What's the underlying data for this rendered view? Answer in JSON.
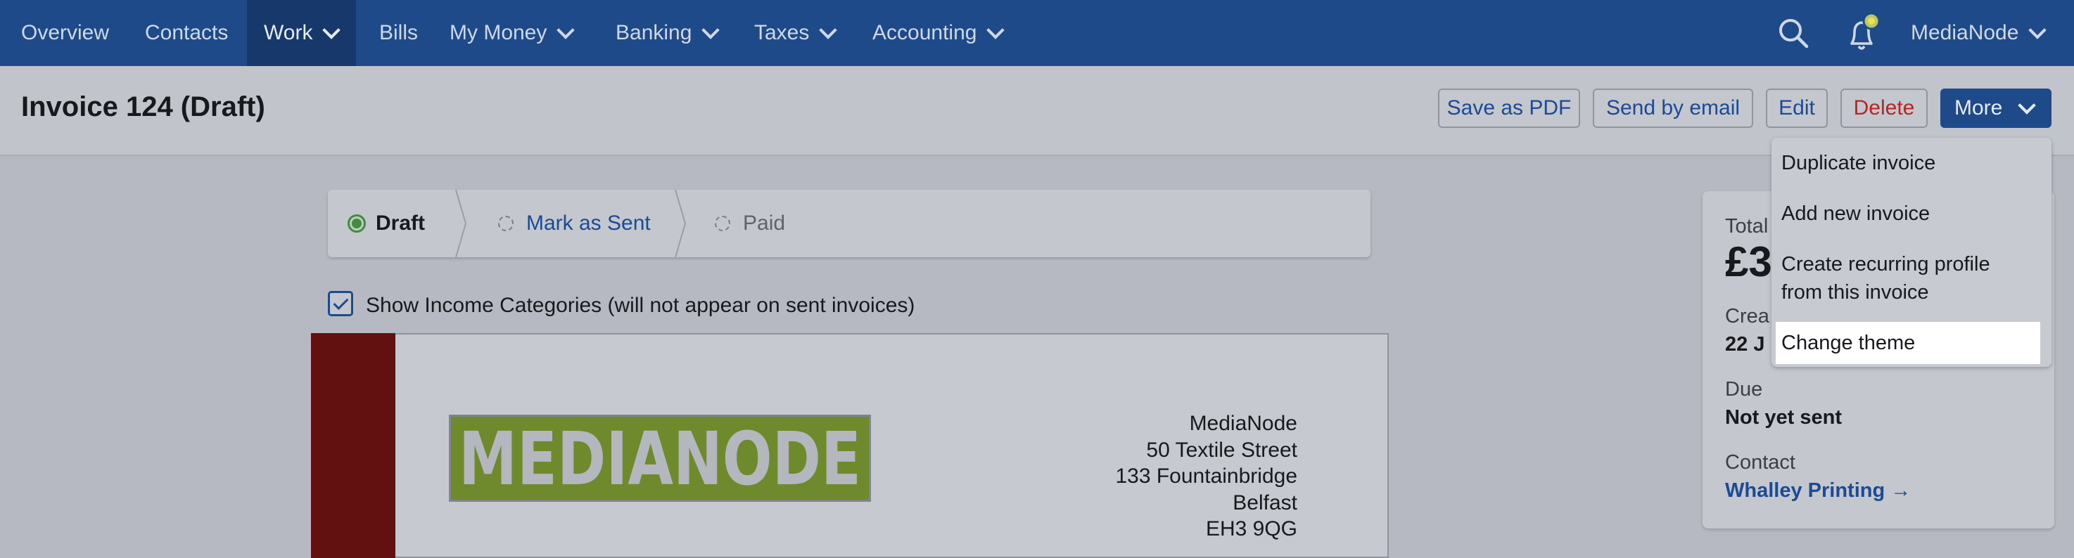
{
  "nav": {
    "items": [
      {
        "label": "Overview"
      },
      {
        "label": "Contacts"
      },
      {
        "label": "Work"
      },
      {
        "label": "Bills"
      },
      {
        "label": "My Money"
      },
      {
        "label": "Banking"
      },
      {
        "label": "Taxes"
      },
      {
        "label": "Accounting"
      }
    ],
    "account_label": "MediaNode",
    "icons": [
      "search-icon",
      "bell-icon",
      "chevron-down-icon"
    ],
    "colors": {
      "bar": "#1f4a8a",
      "active": "#16386b"
    }
  },
  "header": {
    "title": "Invoice 124 (Draft)",
    "buttons": {
      "save_pdf": "Save as PDF",
      "send_email": "Send by email",
      "edit": "Edit",
      "delete": "Delete",
      "more": "More"
    }
  },
  "menu": {
    "items": [
      "Duplicate invoice",
      "Add new invoice",
      "Create recurring profile",
      "from this invoice",
      "Change theme"
    ],
    "highlighted": "Change theme"
  },
  "steps": {
    "draft": "Draft",
    "sent": "Mark as Sent",
    "paid": "Paid",
    "current": "Draft"
  },
  "options": {
    "show_income_label": "Show Income Categories (will not appear on sent invoices)",
    "show_income_checked": true
  },
  "invoice": {
    "logo_text": "MEDIANODE",
    "address": [
      "MediaNode",
      "50 Textile Street",
      "133 Fountainbridge",
      "Belfast",
      "EH3 9QG"
    ],
    "accent_color": "#621010"
  },
  "summary": {
    "total_label": "Total",
    "total_value": "£3",
    "created_label": "Crea",
    "created_value": "22 J",
    "due_label": "Due",
    "due_value": "Not yet sent",
    "contact_label": "Contact",
    "contact_link": "Whalley Printing →"
  }
}
